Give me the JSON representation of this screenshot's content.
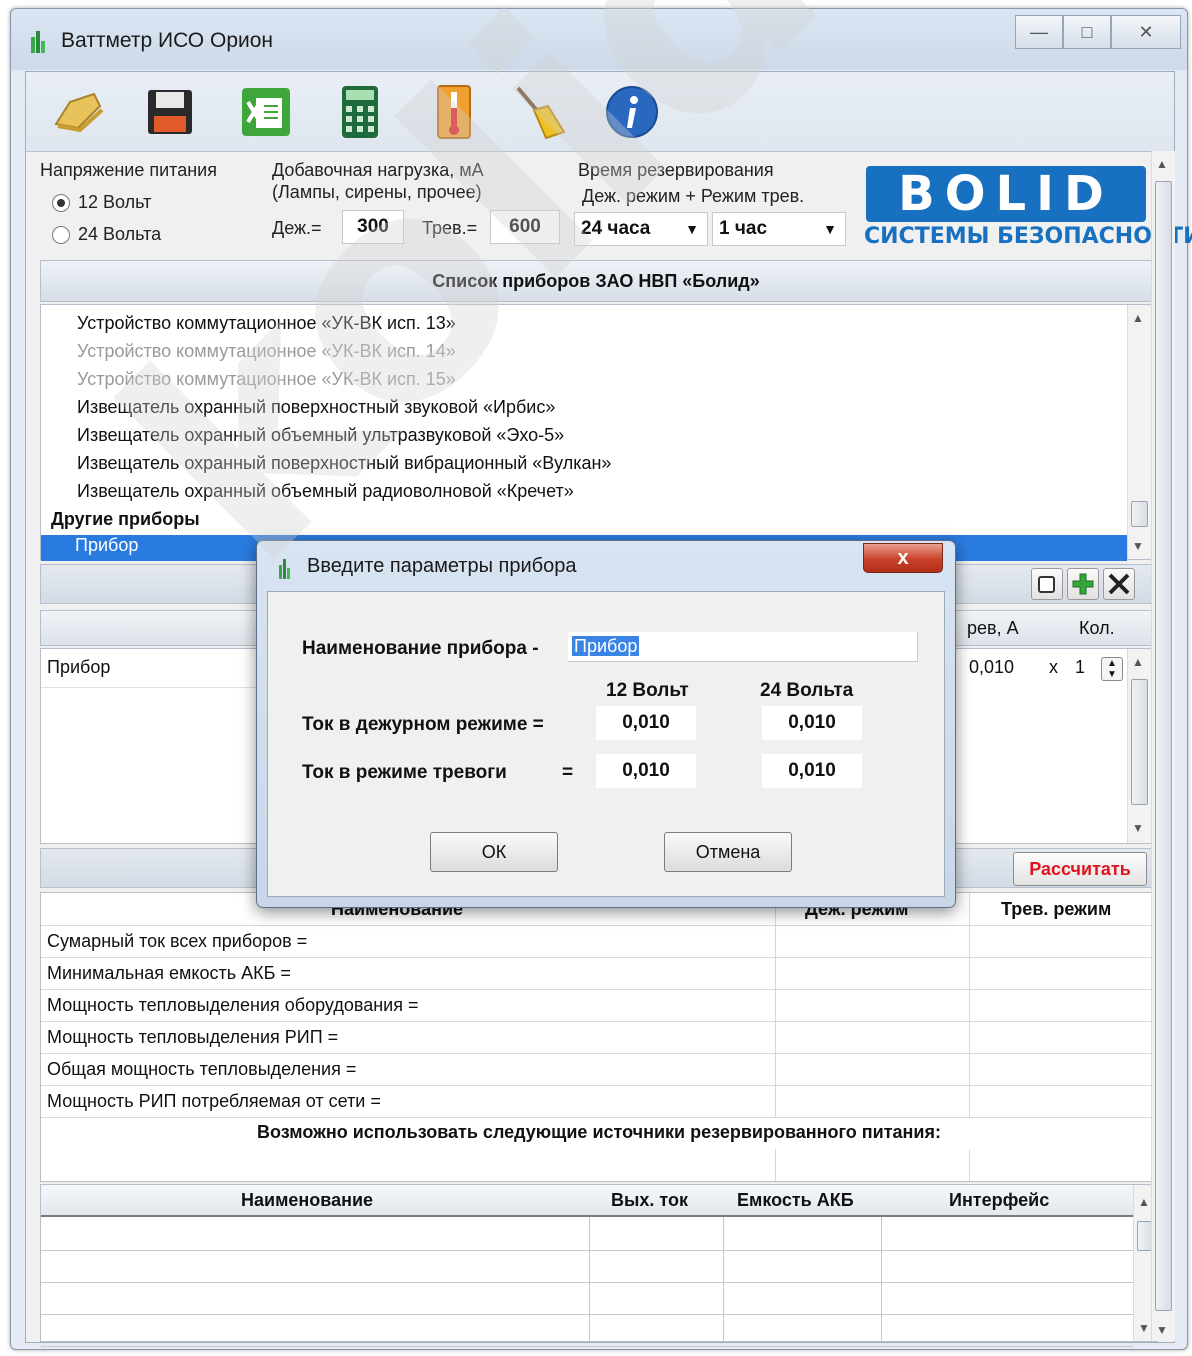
{
  "window": {
    "title": "Ваттметр ИСО Орион",
    "controls": {
      "minimize": "—",
      "maximize": "□",
      "close": "✕"
    }
  },
  "toolbar": {
    "buttons": [
      "open-icon",
      "save-icon",
      "excel-export-icon",
      "calculator-icon",
      "thermometer-icon",
      "clear-broom-icon",
      "info-icon"
    ]
  },
  "supply": {
    "label": "Напряжение питания",
    "options": [
      "12 Вольт",
      "24 Вольта"
    ],
    "selected": "12 Вольт"
  },
  "extra_load": {
    "label_line1": "Добавочная нагрузка, мА",
    "label_line2": "(Лампы, сирены, прочее)",
    "duty_label": "Деж.=",
    "duty_value": "300",
    "alarm_label": "Трев.=",
    "alarm_value": "600"
  },
  "backup_time": {
    "label_line1": "Время резервирования",
    "label_line2": "Деж. режим  +  Режим трев.",
    "duty_value": "24 часа",
    "alarm_value": "1 час"
  },
  "logo": {
    "text": "BOLID",
    "subtitle": "СИСТЕМЫ БЕЗОПАСНОСТИ"
  },
  "device_list": {
    "header": "Список приборов ЗАО НВП «Болид»",
    "items": [
      {
        "label": "Устройство коммутационное «УК-ВК исп. 13»",
        "state": "normal"
      },
      {
        "label": "Устройство коммутационное «УК-ВК исп. 14»",
        "state": "disabled"
      },
      {
        "label": "Устройство коммутационное «УК-ВК исп. 15»",
        "state": "disabled"
      },
      {
        "label": "Извещатель охранный поверхностный звуковой «Ирбис»",
        "state": "normal"
      },
      {
        "label": "Извещатель охранный объемный ультразвуковой «Эхо-5»",
        "state": "normal"
      },
      {
        "label": "Извещатель охранный поверхностный вибрационный «Вулкан»",
        "state": "normal"
      },
      {
        "label": "Извещатель охранный объемный радиоволновой «Кречет»",
        "state": "normal"
      }
    ],
    "group": "Другие приборы",
    "selected_item": "Прибор"
  },
  "device_table": {
    "col_alarm": "рев, А",
    "col_qty": "Кол.",
    "row": {
      "name": "Прибор",
      "alarm": "0,010",
      "x": "x",
      "qty": "1"
    }
  },
  "calculate_label": "Рассчитать",
  "results": {
    "col_name": "Наименование",
    "col_duty": "Деж. режим",
    "col_alarm": "Трев. режим",
    "rows": [
      "Сумарный ток всех приборов =",
      "Минимальная емкость АКБ =",
      "Мощность тепловыделения оборудования =",
      "Мощность тепловыделения РИП =",
      "Общая мощность тепловыделения =",
      "Мощность РИП потребляемая от сети ="
    ]
  },
  "rip": {
    "title": "Возможно использовать следующие источники резервированного питания:",
    "headers": [
      "Наименование",
      "Вых. ток",
      "Емкость АКБ",
      "Интерфейс"
    ]
  },
  "dialog": {
    "title": "Введите параметры прибора",
    "name_label": "Наименование прибора -",
    "name_value": "Прибор",
    "col_12": "12 Вольт",
    "col_24": "24 Вольта",
    "duty_label": "Ток в дежурном режиме =",
    "alarm_label": "Ток в режиме тревоги",
    "alarm_eq": "=",
    "duty_12": "0,010",
    "duty_24": "0,010",
    "alarm_12": "0,010",
    "alarm_24": "0,010",
    "ok": "ОК",
    "cancel": "Отмена",
    "close": "x"
  },
  "watermark": "kolid.ru",
  "colors": {
    "selection": "#2a7be0",
    "brand": "#1870c0",
    "calculate": "#e0141e"
  }
}
